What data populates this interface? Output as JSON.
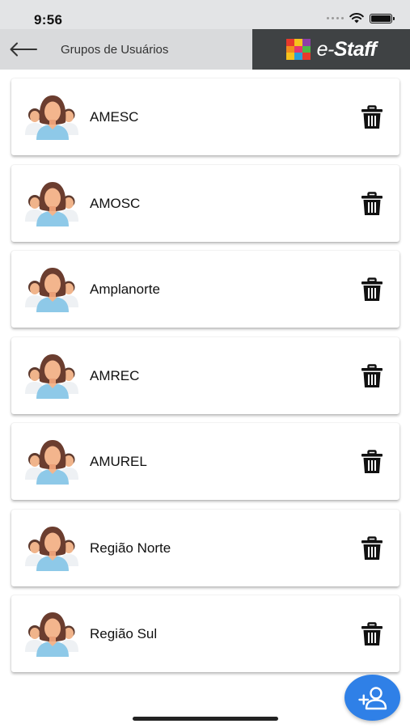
{
  "status_bar": {
    "time": "9:56"
  },
  "header": {
    "title": "Grupos de Usuários",
    "logo_text_prefix": "e-",
    "logo_text_brand": "Staff"
  },
  "groups": [
    {
      "name": "AMESC"
    },
    {
      "name": "AMOSC"
    },
    {
      "name": "Amplanorte"
    },
    {
      "name": "AMREC"
    },
    {
      "name": "AMUREL"
    },
    {
      "name": "Região Norte"
    },
    {
      "name": "Região Sul"
    }
  ],
  "icons": {
    "back": "arrow-left-icon",
    "group": "user-group-avatar-icon",
    "delete": "trash-icon",
    "add": "add-user-icon"
  },
  "colors": {
    "header_bg": "#d9dadc",
    "logo_bg": "#3f4244",
    "fab": "#2f80e7"
  }
}
